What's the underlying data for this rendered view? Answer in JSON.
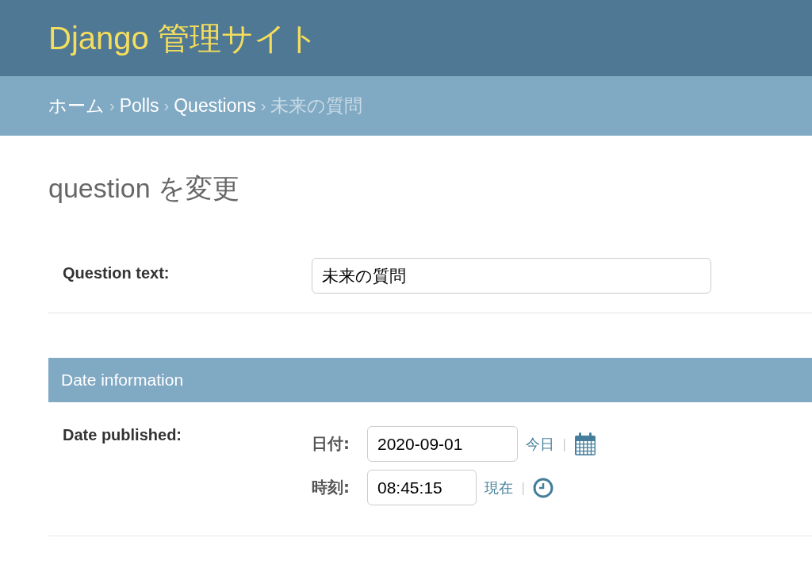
{
  "header": {
    "title": "Django 管理サイト"
  },
  "breadcrumbs": {
    "separator": "›",
    "items": [
      {
        "label": "ホーム",
        "current": false
      },
      {
        "label": "Polls",
        "current": false
      },
      {
        "label": "Questions",
        "current": false
      },
      {
        "label": "未来の質問",
        "current": true
      }
    ]
  },
  "page_title": "question を変更",
  "fields": [
    {
      "label": "Question text:",
      "value": "未来の質問"
    }
  ],
  "fieldset": {
    "title": "Date information",
    "label": "Date published:",
    "parts": [
      {
        "kind": "date",
        "label": "日付:",
        "value": "2020-09-01",
        "shortcut": "今日",
        "separator": "|"
      },
      {
        "kind": "time",
        "label": "時刻:",
        "value": "08:45:15",
        "shortcut": "現在",
        "separator": "|"
      }
    ]
  }
}
